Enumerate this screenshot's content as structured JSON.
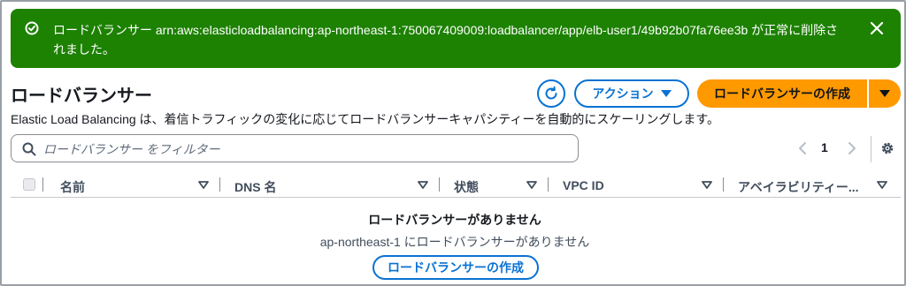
{
  "flash": {
    "message": "ロードバランサー arn:aws:elasticloadbalancing:ap-northeast-1:750067409009:loadbalancer/app/elb-user1/49b92b07fa76ee3b が正常に削除されました。",
    "icon": "success-check-icon",
    "close_icon": "close-icon"
  },
  "header": {
    "title": "ロードバランサー",
    "description": "Elastic Load Balancing は、着信トラフィックの変化に応じてロードバランサーキャパシティーを自動的にスケーリングします。",
    "refresh_icon": "refresh-icon",
    "actions_label": "アクション",
    "create_label": "ロードバランサーの作成"
  },
  "filter": {
    "placeholder": "ロードバランサー をフィルター",
    "value": ""
  },
  "pagination": {
    "current_page": "1"
  },
  "table": {
    "columns": [
      {
        "label": "名前"
      },
      {
        "label": "DNS 名"
      },
      {
        "label": "状態"
      },
      {
        "label": "VPC ID"
      },
      {
        "label": "アベイラビリティー..."
      }
    ],
    "rows": []
  },
  "empty_state": {
    "title": "ロードバランサーがありません",
    "subtitle": "ap-northeast-1 にロードバランサーがありません",
    "button_label": "ロードバランサーの作成"
  },
  "colors": {
    "success": "#1d8102",
    "primary": "#ff9900",
    "link": "#0972d3"
  }
}
